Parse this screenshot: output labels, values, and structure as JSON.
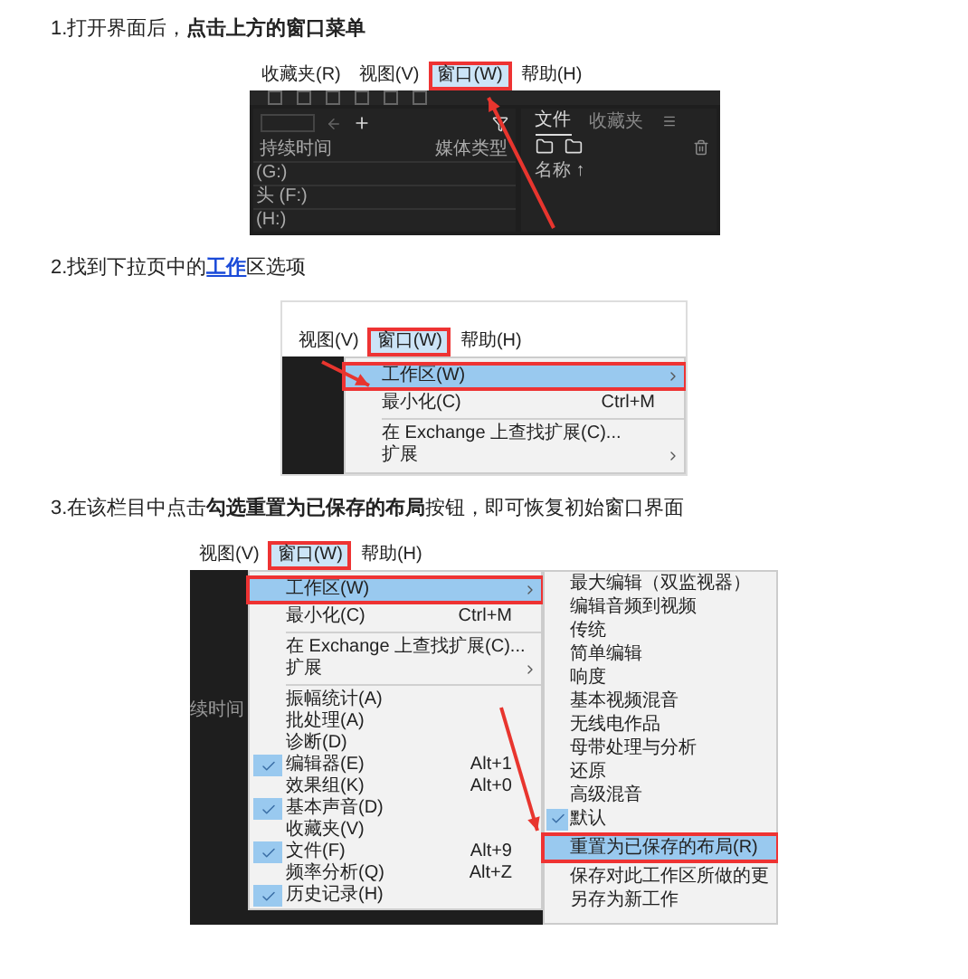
{
  "steps": [
    {
      "parts": [
        {
          "kind": "plain",
          "text": "1.打开界面后，"
        },
        {
          "kind": "bold",
          "text": "点击上方的窗口菜单"
        }
      ],
      "screenshot": {
        "kind": "app",
        "menubar": [
          {
            "label": "收藏夹(R)",
            "selected": false
          },
          {
            "label": "视图(V)",
            "selected": false
          },
          {
            "label": "窗口(W)",
            "selected": true
          },
          {
            "label": "帮助(H)",
            "selected": false
          }
        ],
        "left_panel": {
          "columns": [
            "持续时间",
            "媒体类型"
          ],
          "rows": [
            "(G:)",
            "头 (F:)",
            "(H:)"
          ]
        },
        "right_panel": {
          "tabs": [
            {
              "label": "文件",
              "selected": true
            },
            {
              "label": "收藏夹",
              "selected": false
            }
          ],
          "column": "名称 ↑"
        }
      }
    },
    {
      "parts": [
        {
          "kind": "plain",
          "text": "2.找到下拉页中的"
        },
        {
          "kind": "link",
          "text": "工作"
        },
        {
          "kind": "plain",
          "text": "区选项"
        }
      ],
      "screenshot": {
        "kind": "menu",
        "menubar": [
          {
            "label": "视图(V)",
            "selected": false
          },
          {
            "label": "窗口(W)",
            "selected": true
          },
          {
            "label": "帮助(H)",
            "selected": false
          }
        ],
        "menu": [
          {
            "kind": "item",
            "label": "工作区(W)",
            "submenu": true,
            "selected": true
          },
          {
            "kind": "item",
            "label": "最小化(C)",
            "shortcut": "Ctrl+M",
            "submenu": false,
            "selected": false
          },
          {
            "kind": "separator"
          },
          {
            "kind": "item",
            "label": "在 Exchange 上查找扩展(C)...",
            "submenu": false,
            "selected": false
          },
          {
            "kind": "item",
            "label": "扩展",
            "submenu": true,
            "selected": false
          }
        ]
      }
    },
    {
      "parts": [
        {
          "kind": "plain",
          "text": "3.在该栏目中点击"
        },
        {
          "kind": "bold",
          "text": "勾选重置为已保存的布局"
        },
        {
          "kind": "plain",
          "text": "按钮，即可恢复初始窗口界面"
        }
      ],
      "screenshot": {
        "kind": "menus",
        "menubar": [
          {
            "label": "视图(V)",
            "selected": false
          },
          {
            "label": "窗口(W)",
            "selected": true
          },
          {
            "label": "帮助(H)",
            "selected": false
          }
        ],
        "side_label": "续时间",
        "menu": [
          {
            "kind": "item",
            "label": "工作区(W)",
            "submenu": true,
            "selected": true,
            "checked": false
          },
          {
            "kind": "item",
            "label": "最小化(C)",
            "shortcut": "Ctrl+M",
            "submenu": false,
            "selected": false,
            "checked": false
          },
          {
            "kind": "separator"
          },
          {
            "kind": "item",
            "label": "在 Exchange 上查找扩展(C)...",
            "submenu": false,
            "selected": false,
            "checked": false
          },
          {
            "kind": "item",
            "label": "扩展",
            "submenu": true,
            "selected": false,
            "checked": false
          },
          {
            "kind": "separator"
          },
          {
            "kind": "item",
            "label": "振幅统计(A)",
            "submenu": false,
            "selected": false,
            "checked": false
          },
          {
            "kind": "item",
            "label": "批处理(A)",
            "submenu": false,
            "selected": false,
            "checked": false
          },
          {
            "kind": "item",
            "label": "诊断(D)",
            "submenu": false,
            "selected": false,
            "checked": false
          },
          {
            "kind": "item",
            "label": "编辑器(E)",
            "shortcut": "Alt+1",
            "submenu": false,
            "selected": false,
            "checked": true
          },
          {
            "kind": "item",
            "label": "效果组(K)",
            "shortcut": "Alt+0",
            "submenu": false,
            "selected": false,
            "checked": false
          },
          {
            "kind": "item",
            "label": "基本声音(D)",
            "submenu": false,
            "selected": false,
            "checked": true
          },
          {
            "kind": "item",
            "label": "收藏夹(V)",
            "submenu": false,
            "selected": false,
            "checked": false
          },
          {
            "kind": "item",
            "label": "文件(F)",
            "shortcut": "Alt+9",
            "submenu": false,
            "selected": false,
            "checked": true
          },
          {
            "kind": "item",
            "label": "频率分析(Q)",
            "shortcut": "Alt+Z",
            "submenu": false,
            "selected": false,
            "checked": false
          },
          {
            "kind": "item",
            "label": "历史记录(H)",
            "submenu": false,
            "selected": false,
            "checked": true
          }
        ],
        "submenu": [
          {
            "label": "最大编辑（双监视器）",
            "checked": false,
            "selected": false
          },
          {
            "label": "编辑音频到视频",
            "checked": false,
            "selected": false
          },
          {
            "label": "传统",
            "checked": false,
            "selected": false
          },
          {
            "label": "简单编辑",
            "checked": false,
            "selected": false
          },
          {
            "label": "响度",
            "checked": false,
            "selected": false
          },
          {
            "label": "基本视频混音",
            "checked": false,
            "selected": false
          },
          {
            "label": "无线电作品",
            "checked": false,
            "selected": false
          },
          {
            "label": "母带处理与分析",
            "checked": false,
            "selected": false
          },
          {
            "label": "还原",
            "checked": false,
            "selected": false
          },
          {
            "label": "高级混音",
            "checked": false,
            "selected": false
          },
          {
            "label": "默认",
            "checked": true,
            "selected": false
          },
          {
            "label": "重置为已保存的布局(R)",
            "checked": false,
            "selected": true
          },
          {
            "label": "保存对此工作区所做的更",
            "checked": false,
            "selected": false
          },
          {
            "label": "另存为新工作",
            "checked": false,
            "selected": false
          }
        ]
      }
    }
  ]
}
